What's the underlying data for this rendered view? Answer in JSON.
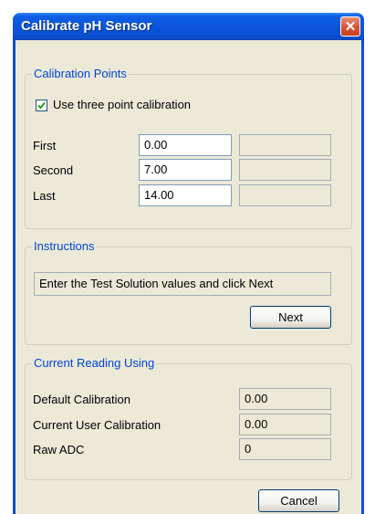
{
  "window": {
    "title": "Calibrate pH Sensor"
  },
  "calibration_points": {
    "legend": "Calibration Points",
    "use_three_point_label": "Use three point calibration",
    "use_three_point_checked": true,
    "rows": [
      {
        "label": "First",
        "value": "0.00",
        "reading": ""
      },
      {
        "label": "Second",
        "value": "7.00",
        "reading": ""
      },
      {
        "label": "Last",
        "value": "14.00",
        "reading": ""
      }
    ]
  },
  "instructions": {
    "legend": "Instructions",
    "text": "Enter the Test Solution values and click Next",
    "next_label": "Next"
  },
  "current_reading": {
    "legend": "Current Reading Using",
    "rows": [
      {
        "label": "Default Calibration",
        "value": "0.00"
      },
      {
        "label": "Current User Calibration",
        "value": "0.00"
      },
      {
        "label": "Raw ADC",
        "value": "0"
      }
    ]
  },
  "footer": {
    "cancel_label": "Cancel"
  },
  "colors": {
    "titlebar": "#0a55d9",
    "close": "#d8532f",
    "legend": "#0046d5",
    "dialog_bg": "#ece9d8"
  }
}
